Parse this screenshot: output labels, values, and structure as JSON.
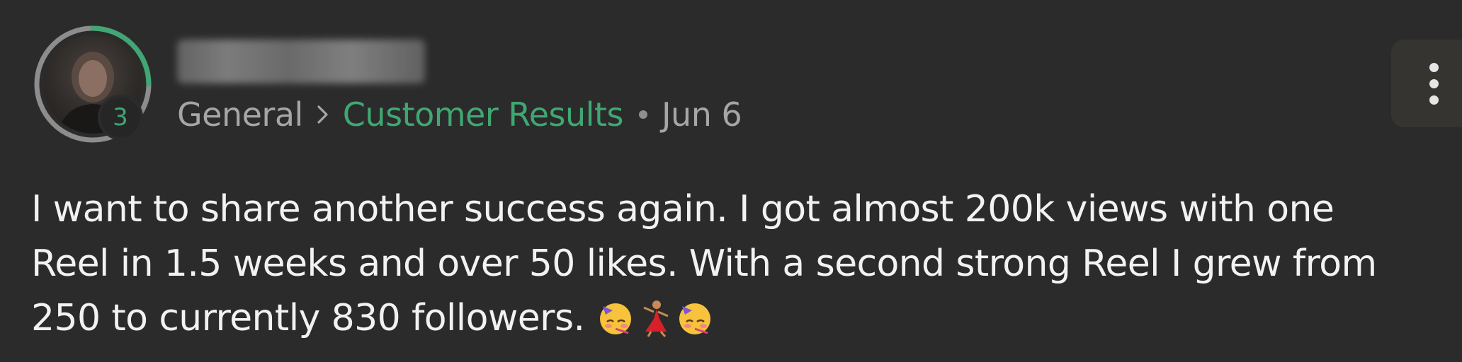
{
  "author": {
    "level": "3",
    "level_progress": 0.25,
    "ring_color": "#41a673"
  },
  "breadcrumb": {
    "root": "General",
    "category": "Customer Results",
    "date": "Jun 6"
  },
  "post": {
    "lines": [
      "I want to share another success again. I got almost 200k views with one",
      "Reel in 1.5 weeks and over 50 likes. With a second strong Reel I grew from",
      "250 to currently 830 followers."
    ],
    "emojis": [
      "partying-face-emoji",
      "woman-dancing-emoji",
      "partying-face-emoji"
    ]
  },
  "icons": {
    "menu": "more-vertical-icon",
    "separator": "chevron-right-icon"
  },
  "colors": {
    "background": "#2b2b2b",
    "accent": "#3fa872",
    "muted_text": "#a6a6a6",
    "body_text": "#f2f2f2"
  }
}
